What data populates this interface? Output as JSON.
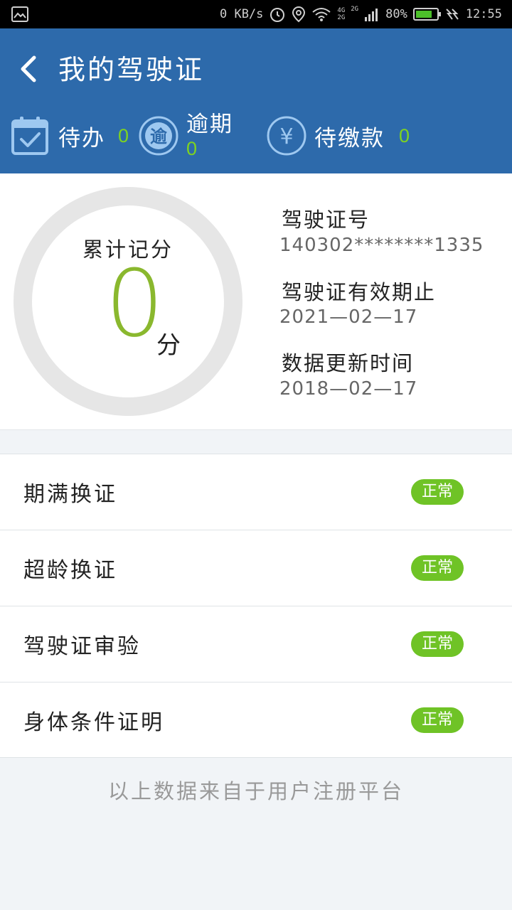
{
  "status_bar": {
    "speed": "0 KB/s",
    "network_4g": "4G",
    "network_2g": "2G",
    "network_2g_alt": "2G",
    "battery": "80%",
    "battery_level": 0.8,
    "time": "12:55",
    "icons": [
      "gallery-icon",
      "alarm-icon",
      "location-icon",
      "wifi-icon",
      "signal-icon",
      "battery-icon",
      "charging-icon"
    ]
  },
  "header": {
    "title": "我的驾驶证",
    "background": "#2d6aab",
    "stats": {
      "todo": {
        "label": "待办",
        "count": "0",
        "icon": "calendar-check-icon"
      },
      "overdue": {
        "label": "逾期",
        "count": "0",
        "icon": "overdue-icon",
        "icon_text": "逾"
      },
      "unpaid": {
        "label": "待缴款",
        "count": "0",
        "icon": "yuan-icon",
        "icon_text": "¥"
      }
    }
  },
  "score": {
    "label": "累计记分",
    "value": "0",
    "unit": "分",
    "accent": "#8ab82e"
  },
  "license": {
    "number_label": "驾驶证号",
    "number": "140302********1335",
    "expiry_label": "驾驶证有效期止",
    "expiry": "2021—02—17",
    "updated_label": "数据更新时间",
    "updated": "2018—02—17"
  },
  "items": [
    {
      "label": "期满换证",
      "status": "正常"
    },
    {
      "label": "超龄换证",
      "status": "正常"
    },
    {
      "label": "驾驶证审验",
      "status": "正常"
    },
    {
      "label": "身体条件证明",
      "status": "正常"
    }
  ],
  "status_color": "#6fc326",
  "footer": "以上数据来自于用户注册平台"
}
